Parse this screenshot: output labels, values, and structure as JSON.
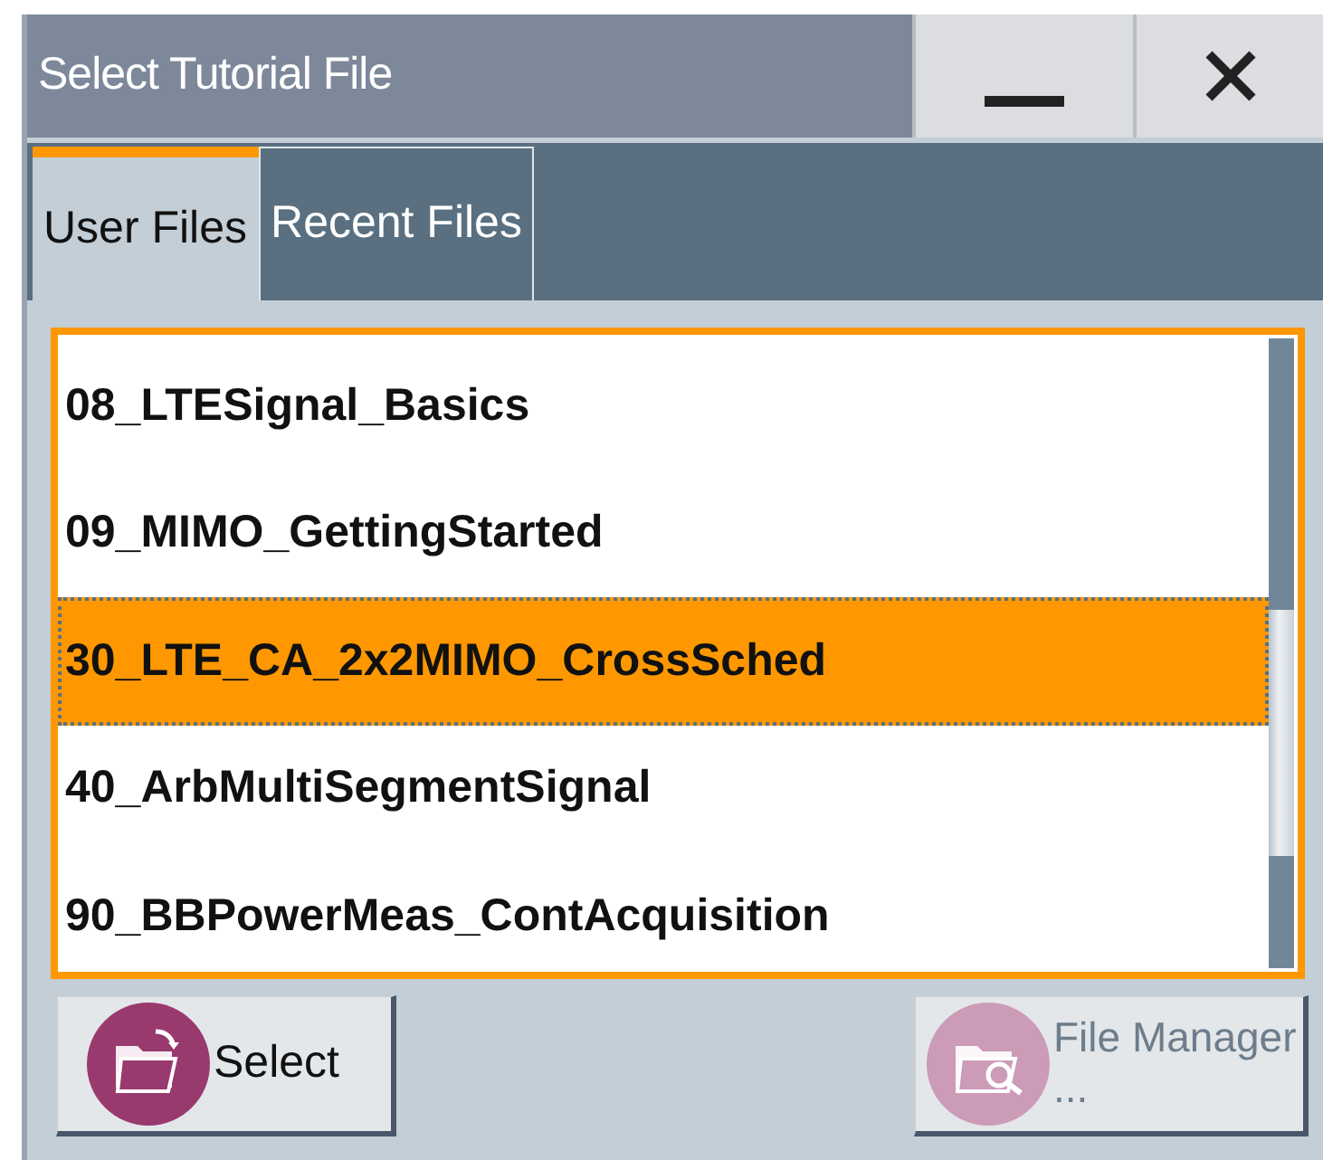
{
  "window": {
    "title": "Select Tutorial File"
  },
  "tabs": [
    {
      "label": "User Files",
      "selected": true
    },
    {
      "label": "Recent Files",
      "selected": false
    }
  ],
  "files": [
    {
      "name": "08_LTESignal_Basics",
      "selected": false
    },
    {
      "name": "09_MIMO_GettingStarted",
      "selected": false
    },
    {
      "name": "30_LTE_CA_2x2MIMO_CrossSched",
      "selected": true
    },
    {
      "name": "40_ArbMultiSegmentSignal",
      "selected": false
    },
    {
      "name": "90_BBPowerMeas_ContAcquisition",
      "selected": false
    }
  ],
  "buttons": [
    {
      "kind": "select",
      "label": "Select",
      "disabled": false
    },
    {
      "kind": "file_manager",
      "label": "File Manager ...",
      "disabled": true
    }
  ]
}
